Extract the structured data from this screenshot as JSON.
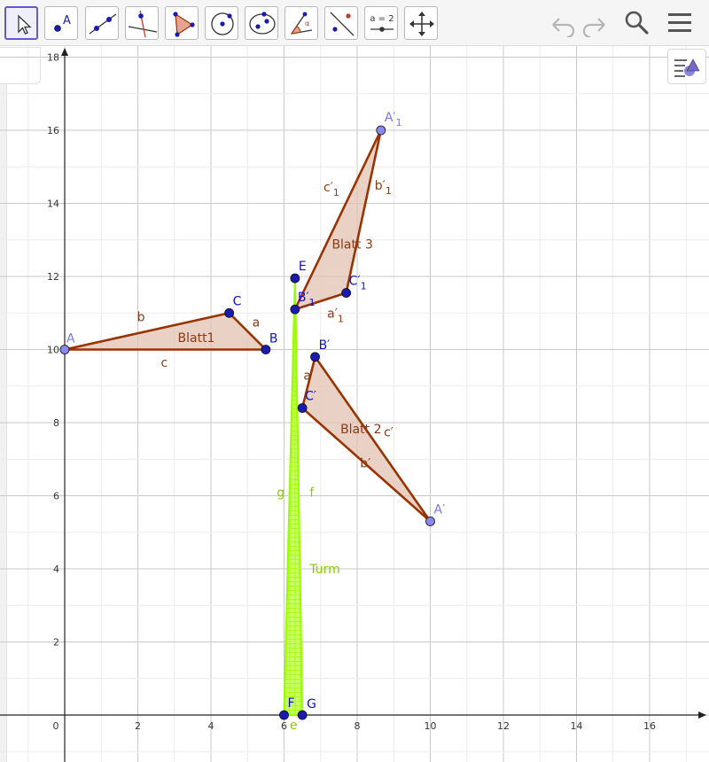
{
  "toolbar": {
    "tools": [
      {
        "name": "move-tool",
        "selected": true
      },
      {
        "name": "point-tool",
        "label": "A"
      },
      {
        "name": "line-tool"
      },
      {
        "name": "perpendicular-line-tool"
      },
      {
        "name": "polygon-tool"
      },
      {
        "name": "circle-center-point-tool"
      },
      {
        "name": "ellipse-tool"
      },
      {
        "name": "angle-tool"
      },
      {
        "name": "reflect-about-line-tool"
      },
      {
        "name": "slider-tool",
        "label": "a = 2"
      },
      {
        "name": "move-graphics-view-tool"
      }
    ],
    "right_buttons": [
      "undo-icon",
      "redo-icon",
      "search-icon",
      "menu-icon"
    ]
  },
  "graphics": {
    "x_ticks": [
      "0",
      "2",
      "4",
      "6",
      "8",
      "10",
      "12",
      "14",
      "16"
    ],
    "y_ticks": [
      "2",
      "4",
      "6",
      "8",
      "10",
      "12",
      "14",
      "16",
      "18"
    ],
    "grid": true,
    "colors": {
      "polygon_stroke": "#993300",
      "polygon_fill": "#e2c2b3",
      "tower": "#99ff00",
      "tower_label": "#88cc00",
      "point_dark": "#1a1ab0",
      "point_light": "#8888ee",
      "label_dark": "#1010cc",
      "label_light": "#7777ee",
      "segment_label": "#8b3a13"
    },
    "polygons": [
      {
        "name": "Blatt1",
        "label": "Blatt1",
        "vertices": [
          [
            0,
            10
          ],
          [
            5.5,
            10
          ],
          [
            4.5,
            11
          ]
        ]
      },
      {
        "name": "Blatt 2",
        "label": "Blatt 2",
        "vertices": [
          [
            10,
            5.3
          ],
          [
            6.85,
            9.8
          ],
          [
            6.5,
            8.4
          ]
        ]
      },
      {
        "name": "Blatt 3",
        "label": "Blatt 3",
        "vertices": [
          [
            8.65,
            16
          ],
          [
            6.3,
            11.1
          ],
          [
            7.7,
            11.55
          ]
        ]
      }
    ],
    "points": [
      {
        "label": "A",
        "x": 0,
        "y": 10,
        "style": "light"
      },
      {
        "label": "B",
        "x": 5.5,
        "y": 10,
        "style": "dark"
      },
      {
        "label": "C",
        "x": 4.5,
        "y": 11,
        "style": "dark"
      },
      {
        "label": "A′",
        "x": 10,
        "y": 5.3,
        "style": "light"
      },
      {
        "label": "B′",
        "x": 6.85,
        "y": 9.8,
        "style": "dark"
      },
      {
        "label": "C′",
        "x": 6.5,
        "y": 8.4,
        "style": "dark"
      },
      {
        "label": "A′1",
        "x": 8.65,
        "y": 16,
        "style": "light"
      },
      {
        "label": "B′1",
        "x": 6.3,
        "y": 11.1,
        "style": "dark"
      },
      {
        "label": "C′1",
        "x": 7.7,
        "y": 11.55,
        "style": "dark"
      },
      {
        "label": "E",
        "x": 6.3,
        "y": 11.95,
        "style": "dark"
      },
      {
        "label": "F",
        "x": 6,
        "y": 0,
        "style": "dark"
      },
      {
        "label": "G",
        "x": 6.5,
        "y": 0,
        "style": "dark"
      }
    ],
    "segment_labels": [
      {
        "text": "a",
        "x": 5.25,
        "y": 10.75
      },
      {
        "text": "b",
        "x": 2.1,
        "y": 10.9
      },
      {
        "text": "c",
        "x": 2.75,
        "y": 9.65
      },
      {
        "text": "a′",
        "x": 6.65,
        "y": 9.3
      },
      {
        "text": "b′",
        "x": 8.2,
        "y": 6.9
      },
      {
        "text": "c′",
        "x": 8.85,
        "y": 7.75
      },
      {
        "text": "a′1",
        "x": 7.3,
        "y": 11.0
      },
      {
        "text": "b′1",
        "x": 8.6,
        "y": 14.5
      },
      {
        "text": "c′1",
        "x": 7.2,
        "y": 14.45
      }
    ],
    "tower": {
      "name": "Turm",
      "label": "Turm",
      "apex": [
        6.3,
        11.95
      ],
      "base_left": [
        6,
        0
      ],
      "base_right": [
        6.5,
        0
      ],
      "left_label": "g",
      "right_label": "f",
      "base_label": "e"
    }
  }
}
